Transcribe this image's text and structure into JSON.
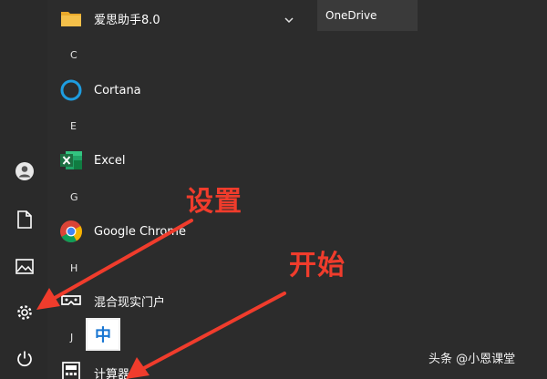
{
  "rail": {
    "items": [
      "user-avatar",
      "documents",
      "pictures",
      "settings",
      "power"
    ]
  },
  "apps": {
    "folder_aisi": {
      "label": "爱思助手8.0"
    },
    "letter_c": "C",
    "cortana": {
      "label": "Cortana"
    },
    "letter_e": "E",
    "excel": {
      "label": "Excel"
    },
    "letter_g": "G",
    "chrome": {
      "label": "Google Chrome"
    },
    "letter_h": "H",
    "mixed_reality": {
      "label": "混合现实门户"
    },
    "letter_j": "J",
    "calculator": {
      "label": "计算器"
    }
  },
  "tiles": {
    "onedrive": "OneDrive"
  },
  "ime": {
    "label": "中"
  },
  "annotations": {
    "settings": "设置",
    "start": "开始"
  },
  "watermark": "头条 @小恩课堂",
  "colors": {
    "background": "#2c2c2c",
    "annotation": "#f03c2c",
    "excel_green": "#1d6f42",
    "cortana_blue": "#1e9de0",
    "folder_yellow": "#f4c04a",
    "ime_blue": "#1976d2"
  }
}
